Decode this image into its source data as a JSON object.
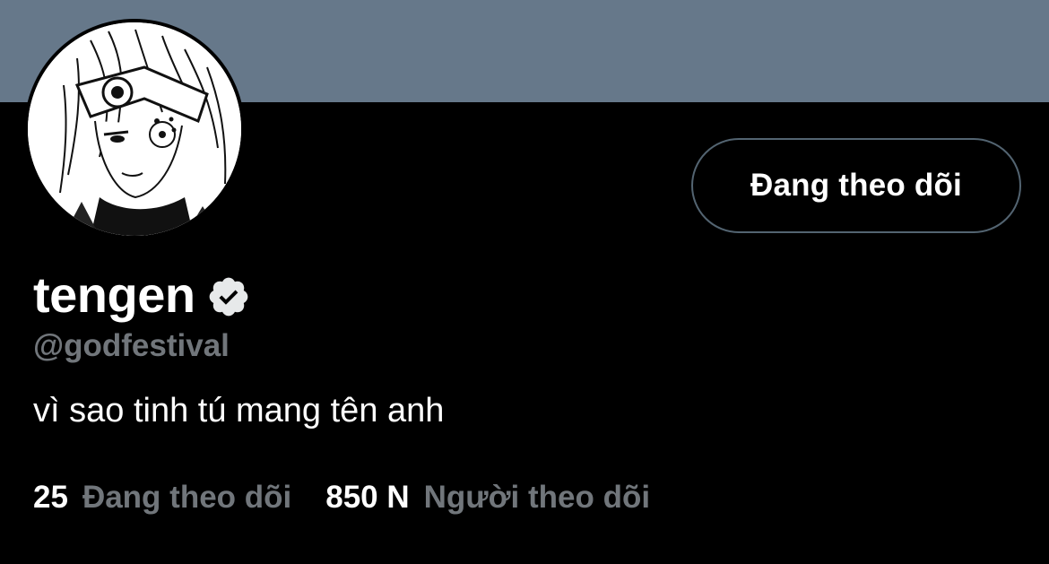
{
  "profile": {
    "display_name": "tengen",
    "verified_icon": "verified-badge-icon",
    "handle": "@godfestival",
    "bio": "vì sao tinh tú mang tên anh"
  },
  "actions": {
    "follow_button_label": "Đang theo dõi"
  },
  "stats": {
    "following_count": "25",
    "following_label": "Đang theo dõi",
    "followers_count": "850 N",
    "followers_label": "Người theo dõi"
  },
  "colors": {
    "banner": "#66788a",
    "background": "#000000",
    "secondary_text": "#71767b",
    "button_border": "#536471"
  }
}
